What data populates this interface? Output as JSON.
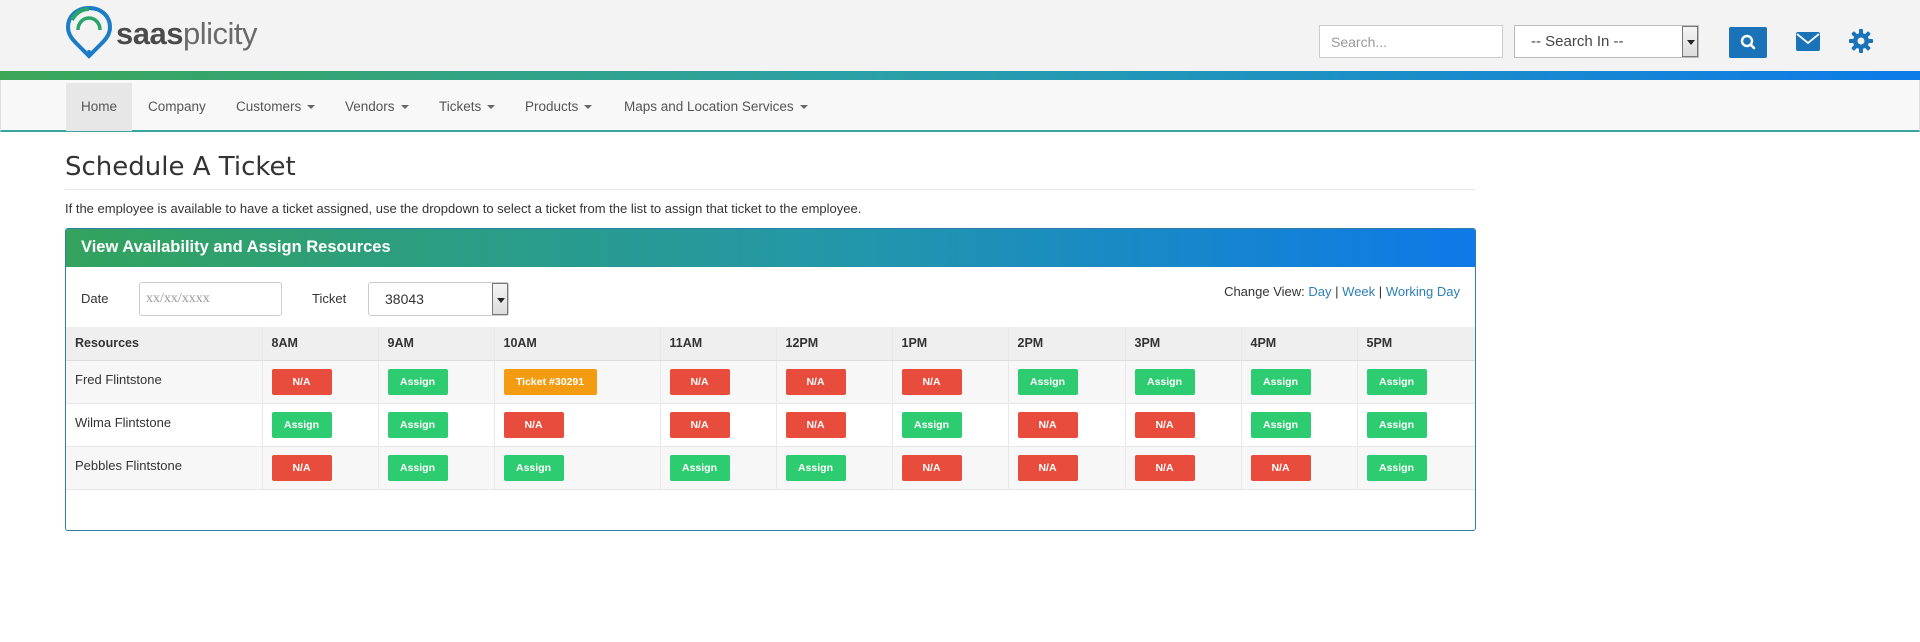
{
  "header": {
    "brand_bold": "saas",
    "brand_light": "plicity",
    "search_placeholder": "Search...",
    "search_in_value": "-- Search In --"
  },
  "nav": {
    "items": [
      {
        "label": "Home",
        "dropdown": false,
        "active": true
      },
      {
        "label": "Company",
        "dropdown": false
      },
      {
        "label": "Customers",
        "dropdown": true
      },
      {
        "label": "Vendors",
        "dropdown": true
      },
      {
        "label": "Tickets",
        "dropdown": true
      },
      {
        "label": "Products",
        "dropdown": true
      },
      {
        "label": "Maps and Location Services",
        "dropdown": true
      }
    ]
  },
  "page": {
    "title": "Schedule A Ticket",
    "intro": "If the employee is available to have a ticket assigned, use the dropdown to select a ticket from the list to assign that ticket to the employee."
  },
  "panel": {
    "title": "View Availability and Assign Resources",
    "date_label": "Date",
    "date_placeholder": "xx/xx/xxxx",
    "ticket_label": "Ticket",
    "ticket_value": "38043",
    "change_view_label": "Change View:",
    "views": [
      "Day",
      "Week",
      "Working Day"
    ]
  },
  "schedule": {
    "resources_header": "Resources",
    "hours": [
      "8AM",
      "9AM",
      "10AM",
      "11AM",
      "12PM",
      "1PM",
      "2PM",
      "3PM",
      "4PM",
      "5PM"
    ],
    "rows": [
      {
        "name": "Fred Flintstone",
        "slots": [
          "N/A",
          "Assign",
          "Ticket #30291",
          "N/A",
          "N/A",
          "N/A",
          "Assign",
          "Assign",
          "Assign",
          "Assign"
        ]
      },
      {
        "name": "Wilma Flintstone",
        "slots": [
          "Assign",
          "Assign",
          "N/A",
          "N/A",
          "N/A",
          "Assign",
          "N/A",
          "N/A",
          "Assign",
          "Assign"
        ]
      },
      {
        "name": "Pebbles Flintstone",
        "slots": [
          "N/A",
          "Assign",
          "Assign",
          "Assign",
          "Assign",
          "N/A",
          "N/A",
          "N/A",
          "N/A",
          "Assign"
        ]
      }
    ]
  },
  "colors": {
    "na": "#e74c3c",
    "assign": "#2ecc71",
    "ticket": "#f39c12",
    "accent": "#1a73b8"
  }
}
